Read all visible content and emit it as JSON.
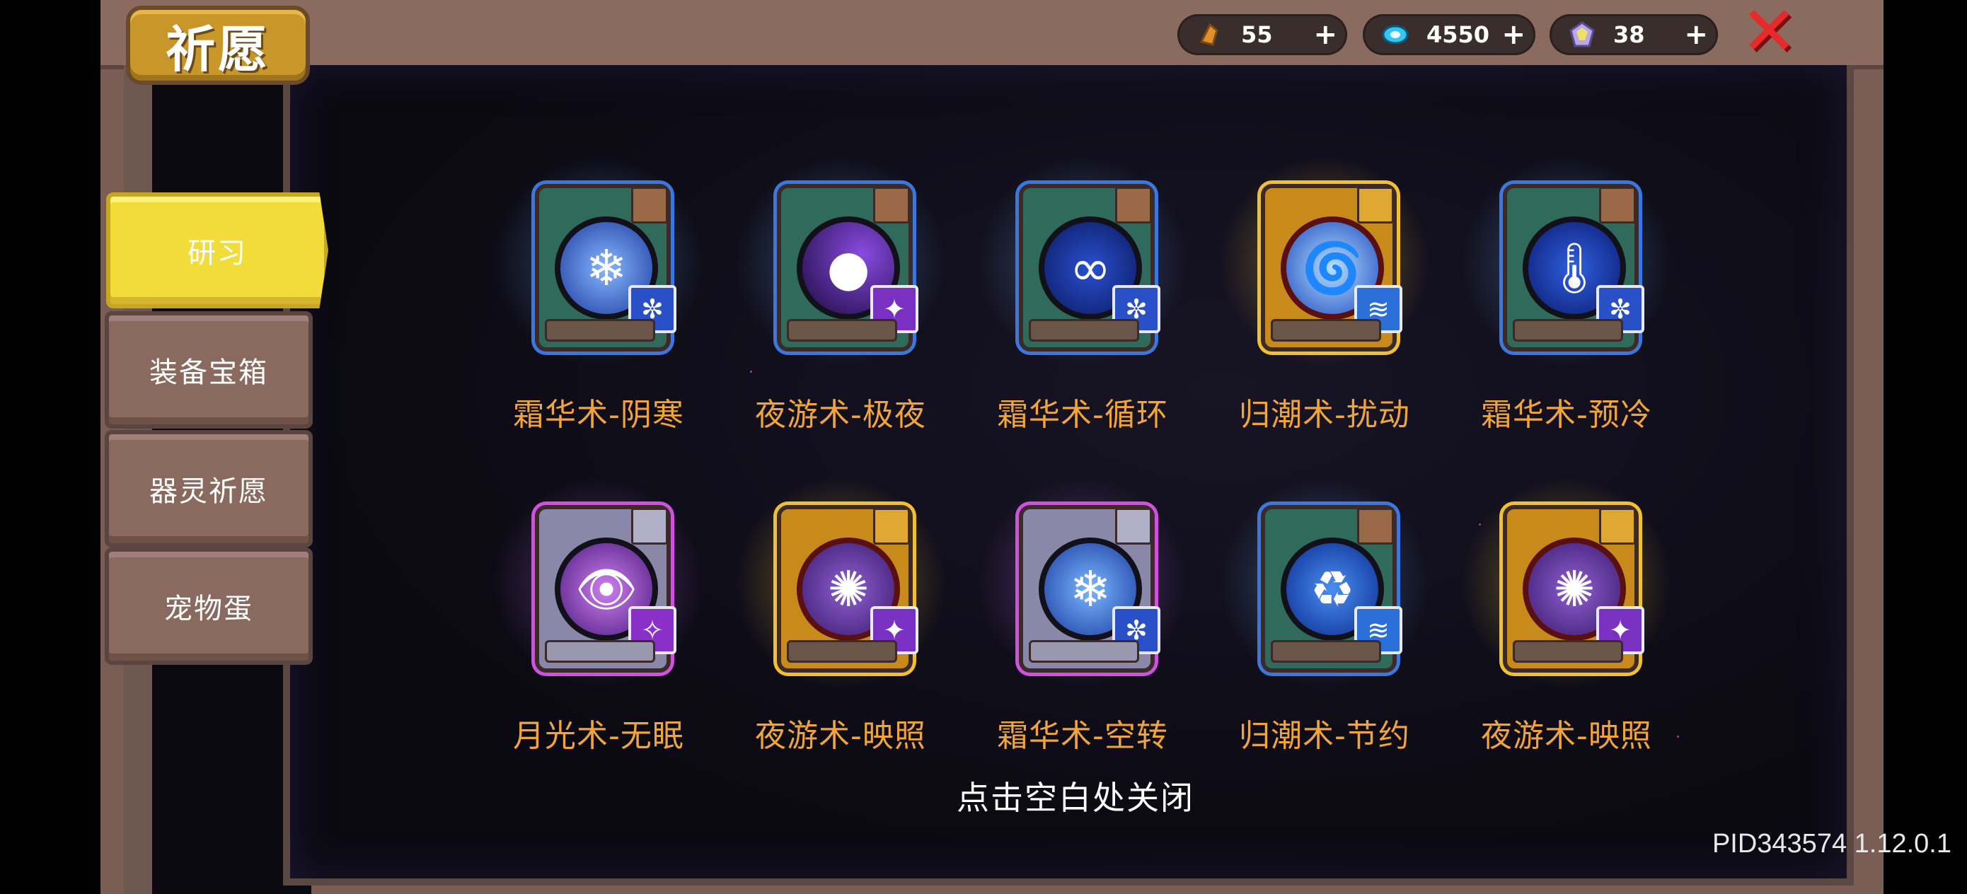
{
  "header": {
    "title": "祈愿",
    "currencies": [
      {
        "icon": "gold-material-icon",
        "value": "55"
      },
      {
        "icon": "blue-gem-icon",
        "value": "4550"
      },
      {
        "icon": "rainbow-crystal-icon",
        "value": "38"
      }
    ],
    "plus": "+",
    "close": "✕"
  },
  "tabs": [
    {
      "label": "研习",
      "active": true
    },
    {
      "label": "装备宝箱",
      "active": false
    },
    {
      "label": "器灵祈愿",
      "active": false
    },
    {
      "label": "宠物蛋",
      "active": false
    }
  ],
  "books": [
    {
      "label": "霜华术-阴寒",
      "rarity": "blue",
      "orb_icon": "frost-spirit-icon",
      "badge_icon": "snowflake-icon"
    },
    {
      "label": "夜游术-极夜",
      "rarity": "blue",
      "orb_icon": "dark-moon-icon",
      "badge_icon": "night-wing-icon"
    },
    {
      "label": "霜华术-循环",
      "rarity": "blue",
      "orb_icon": "infinity-icon",
      "badge_icon": "snowflake-icon"
    },
    {
      "label": "归潮术-扰动",
      "rarity": "gold",
      "orb_icon": "vortex-icon",
      "badge_icon": "tide-icon"
    },
    {
      "label": "霜华术-预冷",
      "rarity": "blue",
      "orb_icon": "thermometer-icon",
      "badge_icon": "snowflake-icon"
    },
    {
      "label": "月光术-无眠",
      "rarity": "purple",
      "orb_icon": "eye-icon",
      "badge_icon": "moonlight-icon"
    },
    {
      "label": "夜游术-映照",
      "rarity": "gold",
      "orb_icon": "specter-icon",
      "badge_icon": "night-wing-icon"
    },
    {
      "label": "霜华术-空转",
      "rarity": "purple",
      "orb_icon": "snow-crystal-icon",
      "badge_icon": "snowflake-icon"
    },
    {
      "label": "归潮术-节约",
      "rarity": "blue",
      "orb_icon": "recycle-icon",
      "badge_icon": "tide-icon"
    },
    {
      "label": "夜游术-映照",
      "rarity": "gold",
      "orb_icon": "specter-icon",
      "badge_icon": "night-wing-icon"
    }
  ],
  "hint": "点击空白处关闭",
  "pid": "PID343574 1.12.0.1",
  "colors": {
    "label": "#f0a43a",
    "tab_active": "#f2dc3a",
    "tab_inactive": "#8a6a5e",
    "close": "#e82a2a"
  }
}
